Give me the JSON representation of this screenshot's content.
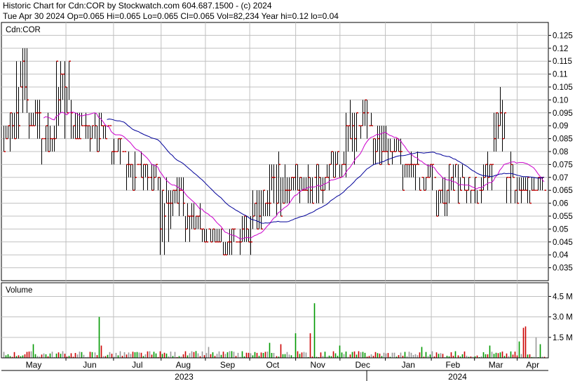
{
  "header": {
    "line1": "Historic Chart for Cdn:COR by Stockwatch.com 604.687.1500 - (c) 2024",
    "line2": "Tue Apr 30 2024  Op=0.065  Hi=0.065  Lo=0.065  Cl=0.065  Vol=82,234  Year hi=0.12  lo=0.04"
  },
  "colors": {
    "background": "#ffffff",
    "grid": "#c0c0c0",
    "price_bar": "#000000",
    "close_tick": "#cc0000",
    "ma_short": "#cc00cc",
    "ma_long": "#000099",
    "vol_up": "#009900",
    "vol_down": "#cc0000",
    "vol_flat": "#999999"
  },
  "chart_data": [
    {
      "type": "ohlc",
      "title": "Cdn:COR",
      "ylim": [
        0.03,
        0.13
      ],
      "y_ticks": [
        "0.035",
        "0.04",
        "0.045",
        "0.05",
        "0.055",
        "0.06",
        "0.065",
        "0.07",
        "0.075",
        "0.08",
        "0.085",
        "0.09",
        "0.095",
        "0.10",
        "0.105",
        "0.11",
        "0.115",
        "0.12",
        "0.125"
      ],
      "x_months": [
        "May",
        "Jun",
        "Jul",
        "Aug",
        "Sep",
        "Oct",
        "Nov",
        "Dec",
        "Jan",
        "Feb",
        "Mar",
        "Apr"
      ],
      "x_years": [
        "2023",
        "2024"
      ],
      "series_note": "Daily OHLC, May 2023 - Apr 30 2024, with short and long moving averages",
      "segments": [
        {
          "len": 6,
          "lo": 0.08,
          "hi": 0.095,
          "close": 0.085
        },
        {
          "len": 6,
          "lo": 0.085,
          "hi": 0.12,
          "close": 0.1
        },
        {
          "len": 6,
          "lo": 0.085,
          "hi": 0.1,
          "close": 0.095
        },
        {
          "len": 7,
          "lo": 0.075,
          "hi": 0.095,
          "close": 0.085
        },
        {
          "len": 8,
          "lo": 0.085,
          "hi": 0.115,
          "close": 0.095
        },
        {
          "len": 8,
          "lo": 0.085,
          "hi": 0.095,
          "close": 0.09
        },
        {
          "len": 10,
          "lo": 0.08,
          "hi": 0.095,
          "close": 0.085
        },
        {
          "len": 7,
          "lo": 0.075,
          "hi": 0.085,
          "close": 0.08
        },
        {
          "len": 8,
          "lo": 0.065,
          "hi": 0.08,
          "close": 0.07
        },
        {
          "len": 8,
          "lo": 0.065,
          "hi": 0.075,
          "close": 0.07
        },
        {
          "len": 6,
          "lo": 0.04,
          "hi": 0.07,
          "close": 0.06
        },
        {
          "len": 6,
          "lo": 0.055,
          "hi": 0.07,
          "close": 0.06
        },
        {
          "len": 8,
          "lo": 0.045,
          "hi": 0.06,
          "close": 0.05
        },
        {
          "len": 10,
          "lo": 0.045,
          "hi": 0.05,
          "close": 0.05
        },
        {
          "len": 8,
          "lo": 0.04,
          "hi": 0.05,
          "close": 0.045
        },
        {
          "len": 6,
          "lo": 0.04,
          "hi": 0.055,
          "close": 0.045
        },
        {
          "len": 8,
          "lo": 0.05,
          "hi": 0.065,
          "close": 0.06
        },
        {
          "len": 8,
          "lo": 0.055,
          "hi": 0.08,
          "close": 0.065
        },
        {
          "len": 10,
          "lo": 0.06,
          "hi": 0.075,
          "close": 0.065
        },
        {
          "len": 10,
          "lo": 0.06,
          "hi": 0.075,
          "close": 0.07
        },
        {
          "len": 8,
          "lo": 0.065,
          "hi": 0.08,
          "close": 0.07
        },
        {
          "len": 5,
          "lo": 0.07,
          "hi": 0.1,
          "close": 0.085
        },
        {
          "len": 8,
          "lo": 0.08,
          "hi": 0.1,
          "close": 0.09
        },
        {
          "len": 7,
          "lo": 0.075,
          "hi": 0.09,
          "close": 0.08
        },
        {
          "len": 7,
          "lo": 0.075,
          "hi": 0.085,
          "close": 0.08
        },
        {
          "len": 8,
          "lo": 0.065,
          "hi": 0.08,
          "close": 0.07
        },
        {
          "len": 8,
          "lo": 0.065,
          "hi": 0.075,
          "close": 0.07
        },
        {
          "len": 6,
          "lo": 0.055,
          "hi": 0.07,
          "close": 0.065
        },
        {
          "len": 8,
          "lo": 0.06,
          "hi": 0.075,
          "close": 0.065
        },
        {
          "len": 8,
          "lo": 0.06,
          "hi": 0.07,
          "close": 0.065
        },
        {
          "len": 5,
          "lo": 0.065,
          "hi": 0.08,
          "close": 0.075
        },
        {
          "len": 6,
          "lo": 0.08,
          "hi": 0.105,
          "close": 0.1
        },
        {
          "len": 4,
          "lo": 0.06,
          "hi": 0.08,
          "close": 0.07
        },
        {
          "len": 7,
          "lo": 0.06,
          "hi": 0.07,
          "close": 0.07
        },
        {
          "len": 8,
          "lo": 0.06,
          "hi": 0.07,
          "close": 0.065
        }
      ]
    },
    {
      "type": "bar",
      "title": "Volume",
      "ylim": [
        0,
        5.5
      ],
      "y_ticks": [
        "1.5 M",
        "3.0 M",
        "4.5 M"
      ],
      "spikes": [
        {
          "pos": 0.176,
          "value": 3.0,
          "dir": "up"
        },
        {
          "pos": 0.18,
          "value": 0.9,
          "dir": "down"
        },
        {
          "pos": 0.053,
          "value": 1.0,
          "dir": "up"
        },
        {
          "pos": 0.38,
          "value": 0.8,
          "dir": "flat"
        },
        {
          "pos": 0.492,
          "value": 1.1,
          "dir": "up"
        },
        {
          "pos": 0.512,
          "value": 1.0,
          "dir": "down"
        },
        {
          "pos": 0.541,
          "value": 1.8,
          "dir": "up"
        },
        {
          "pos": 0.568,
          "value": 1.8,
          "dir": "down"
        },
        {
          "pos": 0.575,
          "value": 4.0,
          "dir": "up"
        },
        {
          "pos": 0.62,
          "value": 0.9,
          "dir": "up"
        },
        {
          "pos": 0.772,
          "value": 0.8,
          "dir": "up"
        },
        {
          "pos": 0.898,
          "value": 0.9,
          "dir": "up"
        },
        {
          "pos": 0.955,
          "value": 1.2,
          "dir": "up"
        },
        {
          "pos": 0.96,
          "value": 2.2,
          "dir": "down"
        },
        {
          "pos": 0.965,
          "value": 2.3,
          "dir": "down"
        },
        {
          "pos": 0.985,
          "value": 1.5,
          "dir": "flat"
        },
        {
          "pos": 0.993,
          "value": 1.0,
          "dir": "up"
        }
      ]
    }
  ]
}
